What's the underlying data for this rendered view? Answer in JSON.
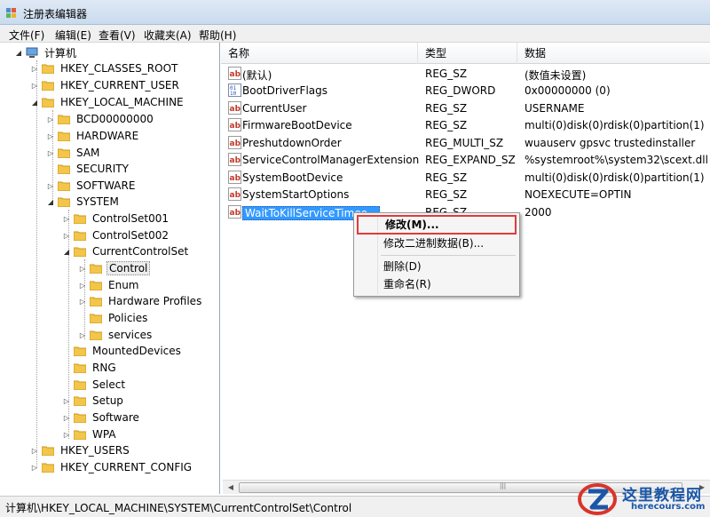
{
  "window": {
    "title": "注册表编辑器"
  },
  "menu": [
    "文件(F)",
    "编辑(E)",
    "查看(V)",
    "收藏夹(A)",
    "帮助(H)"
  ],
  "tree": {
    "root": "计算机",
    "items": [
      "HKEY_CLASSES_ROOT",
      "HKEY_CURRENT_USER",
      "HKEY_LOCAL_MACHINE",
      "BCD00000000",
      "HARDWARE",
      "SAM",
      "SECURITY",
      "SOFTWARE",
      "SYSTEM",
      "ControlSet001",
      "ControlSet002",
      "CurrentControlSet",
      "Control",
      "Enum",
      "Hardware Profiles",
      "Policies",
      "services",
      "MountedDevices",
      "RNG",
      "Select",
      "Setup",
      "Software",
      "WPA",
      "HKEY_USERS",
      "HKEY_CURRENT_CONFIG"
    ]
  },
  "list": {
    "columns": [
      "名称",
      "类型",
      "数据"
    ],
    "rows": [
      {
        "name": "(默认)",
        "type": "REG_SZ",
        "data": "(数值未设置)",
        "icon": "string-value-icon"
      },
      {
        "name": "BootDriverFlags",
        "type": "REG_DWORD",
        "data": "0x00000000 (0)",
        "icon": "binary-value-icon"
      },
      {
        "name": "CurrentUser",
        "type": "REG_SZ",
        "data": "USERNAME",
        "icon": "string-value-icon"
      },
      {
        "name": "FirmwareBootDevice",
        "type": "REG_SZ",
        "data": "multi(0)disk(0)rdisk(0)partition(1)",
        "icon": "string-value-icon"
      },
      {
        "name": "PreshutdownOrder",
        "type": "REG_MULTI_SZ",
        "data": "wuauserv gpsvc trustedinstaller",
        "icon": "string-value-icon"
      },
      {
        "name": "ServiceControlManagerExtension",
        "type": "REG_EXPAND_SZ",
        "data": "%systemroot%\\system32\\scext.dll",
        "icon": "string-value-icon"
      },
      {
        "name": "SystemBootDevice",
        "type": "REG_SZ",
        "data": "multi(0)disk(0)rdisk(0)partition(1)",
        "icon": "string-value-icon"
      },
      {
        "name": "SystemStartOptions",
        "type": "REG_SZ",
        "data": " NOEXECUTE=OPTIN",
        "icon": "string-value-icon"
      },
      {
        "name": "WaitToKillServiceTimeo...",
        "type": "REG_SZ",
        "data": "2000",
        "icon": "string-value-icon"
      }
    ]
  },
  "context_menu": {
    "items": [
      "修改(M)...",
      "修改二进制数据(B)...",
      "删除(D)",
      "重命名(R)"
    ],
    "highlight_color": "#e33a3a"
  },
  "status": {
    "path": "计算机\\HKEY_LOCAL_MACHINE\\SYSTEM\\CurrentControlSet\\Control"
  },
  "watermark": {
    "title": "这里教程网",
    "url": "herecours.com"
  },
  "colors": {
    "selection": "#3399ff",
    "folder": "#f2c64a",
    "accent": "#1a56a8"
  }
}
